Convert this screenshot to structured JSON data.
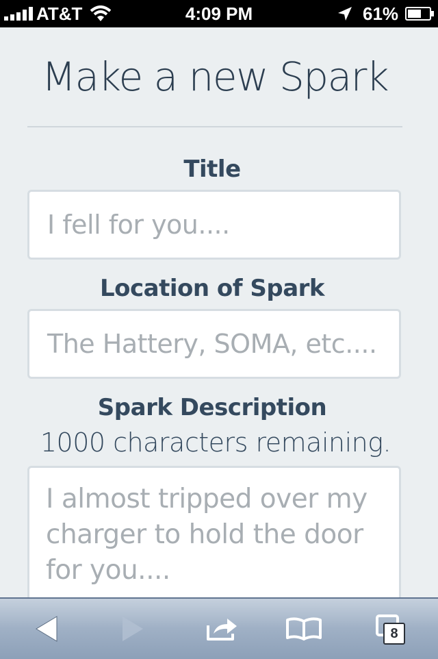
{
  "status_bar": {
    "carrier": "AT&T",
    "time": "4:09 PM",
    "battery_percent": "61%",
    "icons": [
      "signal-icon",
      "wifi-icon",
      "location-arrow-icon",
      "battery-icon"
    ]
  },
  "page": {
    "title": "Make a new Spark",
    "fields": {
      "title": {
        "label": "Title",
        "placeholder": "I fell for you...."
      },
      "location": {
        "label": "Location of Spark",
        "placeholder": "The Hattery, SOMA, etc...."
      },
      "description": {
        "label": "Spark Description",
        "remaining": "1000 characters remaining.",
        "placeholder": "I almost tripped over my\ncharger to hold the door\nfor you...."
      }
    }
  },
  "toolbar": {
    "icons": [
      "back-arrow-icon",
      "forward-arrow-icon",
      "share-icon",
      "bookmarks-icon",
      "tabs-icon"
    ],
    "tabs_count": "8"
  },
  "colors": {
    "page_background": "#ebeff1",
    "heading_text": "#2c3e50",
    "placeholder_text": "#a8aeb3",
    "field_border": "#d6dde2",
    "toolbar_top": "#c5d0dd",
    "toolbar_bottom": "#8da0b8"
  }
}
